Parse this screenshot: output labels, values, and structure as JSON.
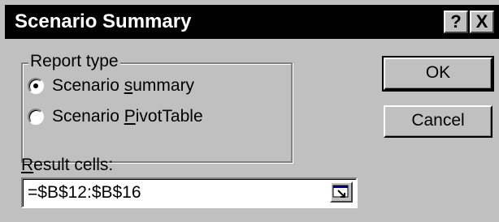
{
  "window": {
    "title": "Scenario Summary",
    "help_button": "?",
    "close_button": "X"
  },
  "report_type": {
    "legend": "Report type",
    "options": [
      {
        "pre": "Scenario ",
        "key": "s",
        "post": "ummary",
        "checked": true
      },
      {
        "pre": "Scenario ",
        "key": "P",
        "post": "ivotTable",
        "checked": false
      }
    ]
  },
  "buttons": {
    "ok": "OK",
    "cancel": "Cancel"
  },
  "result_cells": {
    "label_key": "R",
    "label_rest": "esult cells:",
    "value": "=$B$12:$B$16",
    "collapse_icon": "collapse-dialog-icon"
  }
}
